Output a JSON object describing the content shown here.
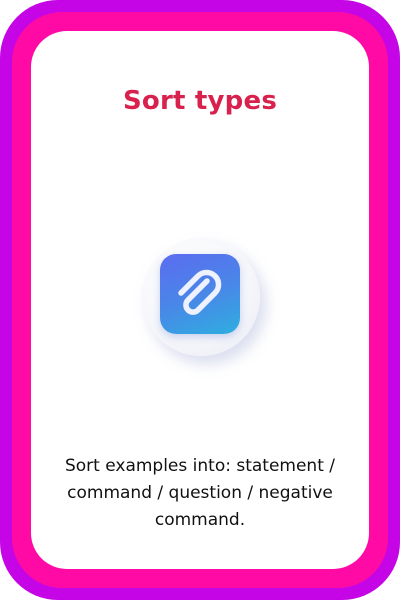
{
  "card": {
    "title": "Sort types",
    "description": "Sort examples into: statement / command / question / negative command.",
    "icon": "paperclip-icon"
  },
  "colors": {
    "outer_frame": "#c505e6",
    "inner_frame": "#ff0aa5",
    "title": "#d8214d",
    "icon_gradient_start": "#5b6cf0",
    "icon_gradient_end": "#2eaee0"
  }
}
